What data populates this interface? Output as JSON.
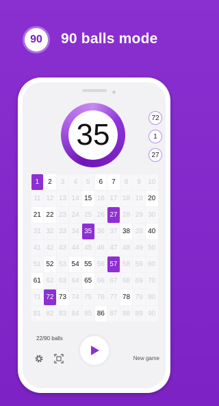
{
  "header": {
    "mode_ball": "90",
    "title": "90 balls mode"
  },
  "current_ball": "35",
  "recent_balls": [
    "72",
    "1",
    "27"
  ],
  "board": {
    "drawn": [
      1,
      2,
      6,
      7,
      15,
      20,
      21,
      22,
      27,
      35,
      38,
      40,
      52,
      54,
      55,
      57,
      61,
      65,
      72,
      73,
      78,
      86
    ],
    "selected": [
      1,
      27,
      35,
      57,
      72
    ]
  },
  "status": "22/90 balls",
  "toolbar": {
    "new_game_label": "New game"
  },
  "icons": [
    "settings-icon",
    "scan-icon",
    "play-icon"
  ],
  "colors": {
    "accent": "#8e2fd4",
    "background": "#7d22c4"
  }
}
